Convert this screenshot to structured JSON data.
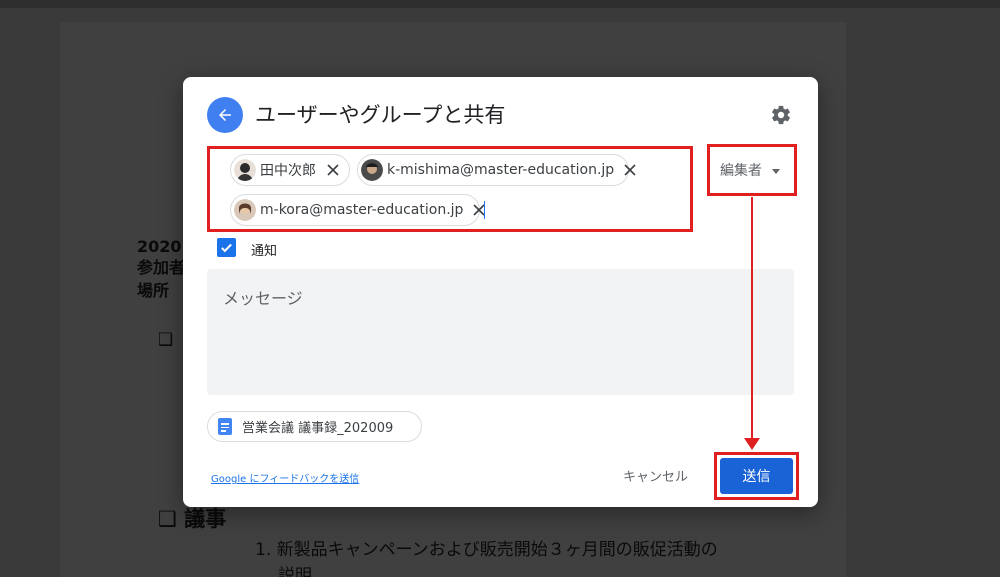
{
  "background_doc": {
    "year": "2020",
    "attendees_label": "参加者",
    "place_label": "場所",
    "agenda_heading": "❑ 議事",
    "box_marker": "❑",
    "agenda_item_1": "1.  新製品キャンペーンおよび販売開始３ヶ月間の販促活動の",
    "agenda_item_1_cont": "説明"
  },
  "dialog": {
    "title": "ユーザーやグループと共有",
    "back_icon": "arrow-left-icon",
    "settings_icon": "gear-icon",
    "recipients": [
      {
        "label": "田中次郎"
      },
      {
        "label": "k-mishima@master-education.jp"
      },
      {
        "label": "m-kora@master-education.jp"
      }
    ],
    "role": "編集者",
    "notify_label": "通知",
    "notify_checked": true,
    "message_placeholder": "メッセージ",
    "file_name": "営業会議 議事録_202009",
    "feedback_link": "Google にフィードバックを送信",
    "cancel_label": "キャンセル",
    "send_label": "送信"
  },
  "colors": {
    "accent": "#1a73e8",
    "annotation": "#e02020",
    "overlay": "#3a3a3a"
  }
}
